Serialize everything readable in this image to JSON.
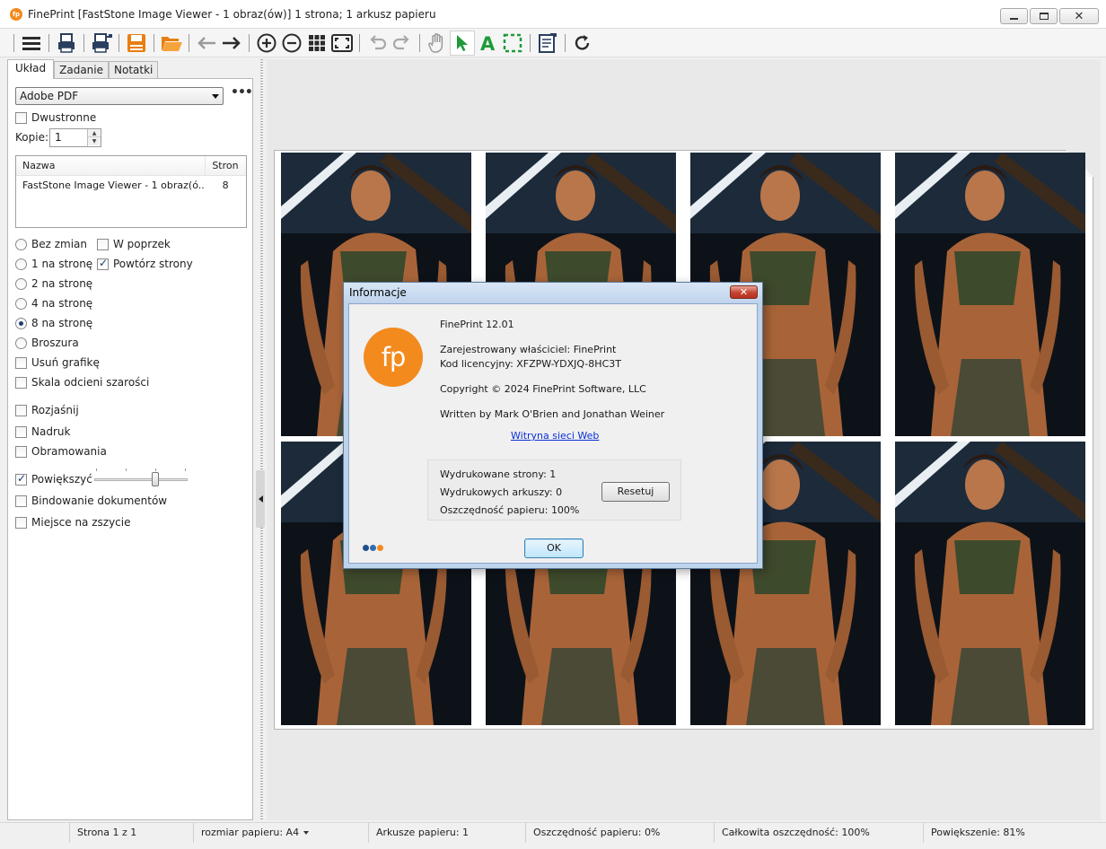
{
  "window": {
    "title": "FinePrint [FastStone Image Viewer - 1 obraz(ów)] 1 strona; 1 arkusz papieru",
    "app_icon_text": "fp"
  },
  "toolbar": {
    "icons": [
      "menu-icon",
      "print-icon",
      "print-settings-icon",
      "save-icon",
      "open-folder-icon",
      "back-icon",
      "forward-icon",
      "zoom-in-icon",
      "zoom-out-icon",
      "grid-view-icon",
      "fit-page-icon",
      "undo-icon",
      "redo-icon",
      "hand-icon",
      "select-arrow-icon",
      "text-icon",
      "crop-icon",
      "notes-icon",
      "refresh-icon"
    ],
    "accent_green": "#1f9a3a",
    "accent_orange": "#e87f12"
  },
  "left_panel": {
    "tabs": [
      "Układ",
      "Zadanie",
      "Notatki"
    ],
    "printer": "Adobe PDF",
    "more_label": "•••",
    "duplex_label": "Dwustronne",
    "copies_label": "Kopie:",
    "copies_value": "1",
    "job_list": {
      "headers": [
        "Nazwa",
        "Stron"
      ],
      "rows": [
        {
          "name": "FastStone Image Viewer - 1 obraz(ó...",
          "pages": "8"
        }
      ]
    },
    "layout_options": [
      {
        "label": "Bez zmian",
        "checked": false
      },
      {
        "label": "1 na stronę",
        "checked": false
      },
      {
        "label": "2 na stronę",
        "checked": false
      },
      {
        "label": "4 na stronę",
        "checked": false
      },
      {
        "label": "8 na stronę",
        "checked": true
      },
      {
        "label": "Broszura",
        "checked": false
      }
    ],
    "across_label": "W poprzek",
    "repeat_label": "Powtórz strony",
    "remove_graphics_label": "Usuń grafikę",
    "grayscale_label": "Skala odcieni szarości",
    "lighten_label": "Rozjaśnij",
    "stamp_label": "Nadruk",
    "borders_label": "Obramowania",
    "enlarge_label": "Powiększyć",
    "enlarge_level": 0.66,
    "binding_label": "Bindowanie dokumentów",
    "gutter_label": "Miejsce na zszycie"
  },
  "dialog": {
    "title": "Informacje",
    "close": "✕",
    "logo_text": "fp",
    "product": "FinePrint 12.01",
    "owner_line": "Zarejestrowany właściciel:  FinePrint",
    "license_line": "Kod licencyjny:  XFZPW-YDXJQ-8HC3T",
    "copyright": "Copyright © 2024 FinePrint Software, LLC",
    "authors": "Written by Mark O'Brien and Jonathan Weiner",
    "website_link": "Witryna sieci Web",
    "stats": {
      "printed_pages": "Wydrukowane strony:  1",
      "printed_sheets": "Wydrukowych arkuszy:  0",
      "paper_savings": "Oszczędność papieru:  100%"
    },
    "reset_label": "Resetuj",
    "ok_label": "OK",
    "dot_colors": [
      "#1f4e8c",
      "#2f6db3",
      "#f28a1e"
    ]
  },
  "preview": {
    "pages_on_sheet": 8
  },
  "status_bar": {
    "page": "Strona 1 z 1",
    "paper_size": "rozmiar papieru: A4",
    "sheets": "Arkusze papieru: 1",
    "savings": "Oszczędność papieru: 0%",
    "total_savings": "Całkowita oszczędność: 100%",
    "zoom": "Powiększenie: 81%"
  }
}
